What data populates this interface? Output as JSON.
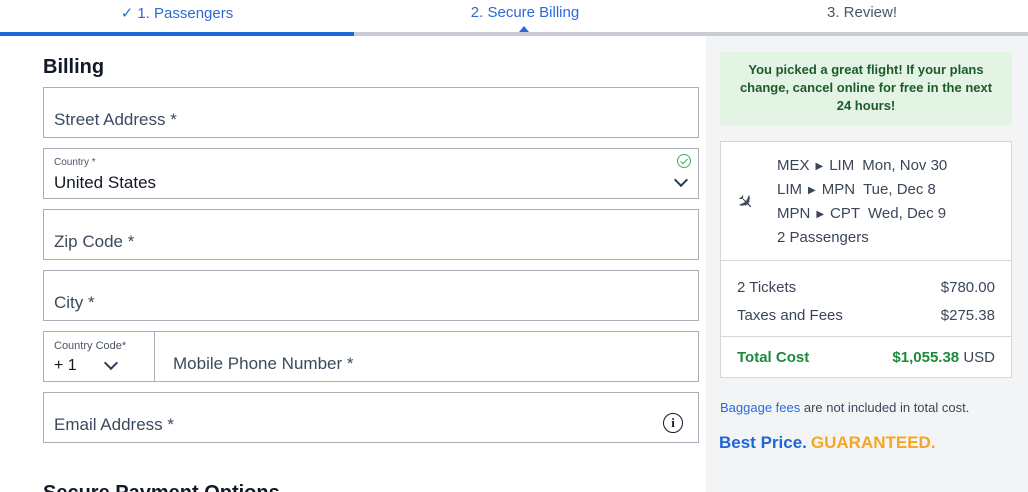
{
  "stepper": {
    "step1_check": "✓",
    "step1": "1. Passengers",
    "step2": "2. Secure Billing",
    "step3": "3. Review!"
  },
  "billing": {
    "title": "Billing",
    "street_placeholder": "Street Address *",
    "country_label": "Country *",
    "country_value": "United States",
    "zip_placeholder": "Zip Code *",
    "city_placeholder": "City *",
    "country_code_label": "Country Code*",
    "country_code_value": "+ 1",
    "phone_placeholder": "Mobile Phone Number *",
    "email_placeholder": "Email Address *",
    "next_section": "Secure Payment Options"
  },
  "summary": {
    "promo_lines": [
      "You picked a great flight! If your plans",
      "change, cancel online for free in the next",
      "24 hours!"
    ],
    "legs": [
      {
        "from": "MEX",
        "to": "LIM",
        "date": "Mon, Nov 30"
      },
      {
        "from": "LIM",
        "to": "MPN",
        "date": "Tue, Dec 8"
      },
      {
        "from": "MPN",
        "to": "CPT",
        "date": "Wed, Dec 9"
      }
    ],
    "passengers": "2 Passengers",
    "tickets_label": "2 Tickets",
    "tickets_amount": "$780.00",
    "taxes_label": "Taxes and Fees",
    "taxes_amount": "$275.38",
    "total_label": "Total Cost",
    "total_amount": "$1,055.38",
    "currency": "USD",
    "baggage_link": "Baggage fees",
    "baggage_note": " are not included in total cost.",
    "best_price": "Best Price.",
    "guaranteed": "GUARANTEED."
  },
  "colors": {
    "accent": "#1f66d6",
    "success": "#1c8a3a",
    "promo_bg": "#e3f4e5",
    "guarantee": "#f5a623"
  }
}
